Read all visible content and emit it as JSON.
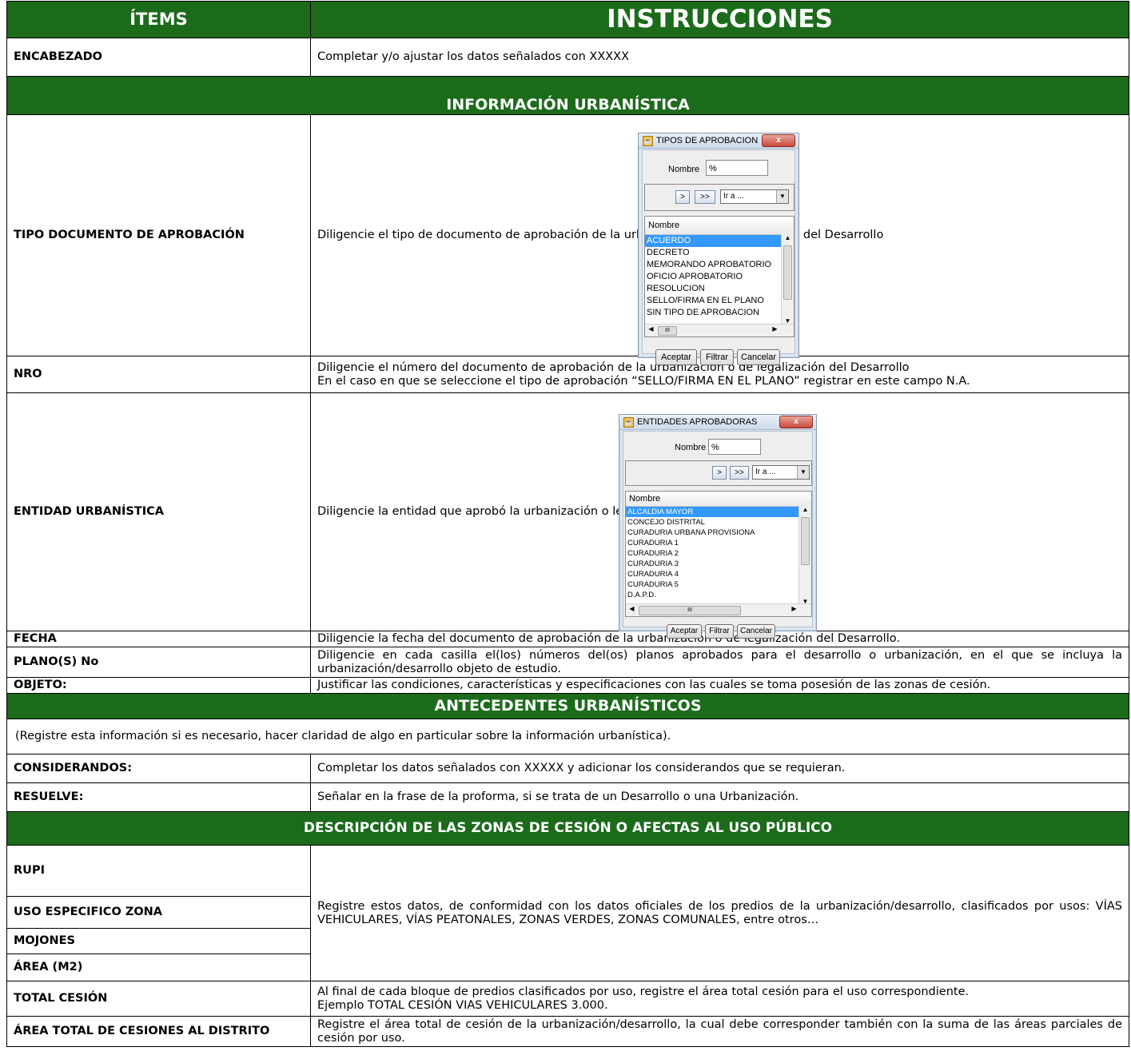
{
  "header": {
    "col1": "ÍTEMS",
    "col2": "INSTRUCCIONES"
  },
  "encabezado": {
    "label": "ENCABEZADO",
    "text": "Completar y/o ajustar los datos señalados con XXXXX"
  },
  "info_urbanistica": {
    "title": "INFORMACIÓN URBANÍSTICA",
    "tipo_doc": {
      "label": "TIPO DOCUMENTO DE APROBACIÓN",
      "text": "Diligencie el tipo de documento de aprobación de la urbanización o de legalización del Desarrollo"
    },
    "nro": {
      "label": "NRO",
      "line1": "Diligencie el número del documento de aprobación de la urbanización o de legalización del Desarrollo",
      "line2": "En el caso en que se seleccione el tipo de aprobación “SELLO/FIRMA EN EL PLANO” registrar en este campo N.A."
    },
    "entidad": {
      "label": "ENTIDAD URBANÍSTICA",
      "text": "Diligencie la entidad que aprobó la urbanización o legalizó el Desarrollo"
    },
    "fecha": {
      "label": "FECHA",
      "text": "Diligencie la fecha del documento de aprobación de la urbanización o de legalización del Desarrollo."
    },
    "plano": {
      "label": "PLANO(S) No",
      "text": "Diligencie en cada casilla el(los) números del(os) planos aprobados para el desarrollo o urbanización, en el que se incluya la urbanización/desarrollo objeto de estudio."
    },
    "objeto": {
      "label": "OBJETO:",
      "text": "Justificar las condiciones, características y especificaciones con las cuales se toma posesión de las  zonas de cesión."
    }
  },
  "dialog_tipos": {
    "title": "TIPOS DE APROBACION",
    "close": "x",
    "nombre_label": "Nombre",
    "nombre_value": "%",
    "next": ">",
    "last": ">>",
    "combo": "Ir a ...",
    "column": "Nombre",
    "items": [
      "ACUERDO",
      "DECRETO",
      "MEMORANDO APROBATORIO",
      "OFICIO APROBATORIO",
      "RESOLUCION",
      "SELLO/FIRMA EN EL PLANO",
      "SIN TIPO DE APROBACION"
    ],
    "selected_index": 0,
    "hscroll_mark": "III",
    "btn_accept": "Aceptar",
    "btn_filter": "Filtrar",
    "btn_cancel": "Cancelar"
  },
  "dialog_entidades": {
    "title": "ENTIDADES APROBADORAS",
    "close": "x",
    "nombre_label": "Nombre",
    "nombre_value": "%",
    "next": ">",
    "last": ">>",
    "combo": "Ir a ...",
    "column": "Nombre",
    "items": [
      "ALCALDIA MAYOR",
      "CONCEJO DISTRITAL",
      "CURADURIA URBANA PROVISIONA",
      "CURADURIA 1",
      "CURADURIA 2",
      "CURADURIA 3",
      "CURADURIA 4",
      "CURADURIA 5",
      "D.A.P.D."
    ],
    "selected_index": 0,
    "hscroll_mark": "III",
    "btn_accept": "Aceptar",
    "btn_filter": "Filtrar",
    "btn_cancel": "Cancelar"
  },
  "antecedentes": {
    "title": "ANTECEDENTES URBANÍSTICOS",
    "note": "(Registre esta información si es necesario, hacer claridad de algo en particular sobre la información urbanística).",
    "considerandos": {
      "label": "CONSIDERANDOS:",
      "text": "Completar los datos señalados con XXXXX y adicionar los considerandos que se requieran."
    },
    "resuelve": {
      "label": "RESUELVE:",
      "text": "Señalar en la frase de la proforma, si se trata de un Desarrollo o una Urbanización."
    }
  },
  "zonas": {
    "title": "DESCRIPCIÓN DE LAS ZONAS DE CESIÓN O AFECTAS AL USO PÚBLICO",
    "rupi": "RUPI",
    "uso": "USO ESPECIFICO ZONA",
    "mojones": "MOJONES",
    "area": "ÁREA (M2)",
    "shared_text": "Registre estos datos, de conformidad con los datos oficiales de los predios de la urbanización/desarrollo, clasificados por usos: VÍAS VEHICULARES, VÍAS PEATONALES, ZONAS VERDES, ZONAS COMUNALES, entre otros…",
    "total": {
      "label": "TOTAL CESIÓN",
      "line1": "Al final de cada bloque de predios clasificados por uso, registre el área total cesión para el uso correspondiente.",
      "line2": "Ejemplo TOTAL CESIÓN VIAS VEHICULARES 3.000."
    },
    "area_total": {
      "label": "ÁREA TOTAL DE CESIONES AL DISTRITO",
      "text": "Registre el área total de cesión de la urbanización/desarrollo, la cual debe corresponder también con la suma de las áreas parciales de cesión por uso."
    }
  },
  "colors": {
    "header_green": "#1b6b1b",
    "selection_blue": "#3399ff"
  }
}
